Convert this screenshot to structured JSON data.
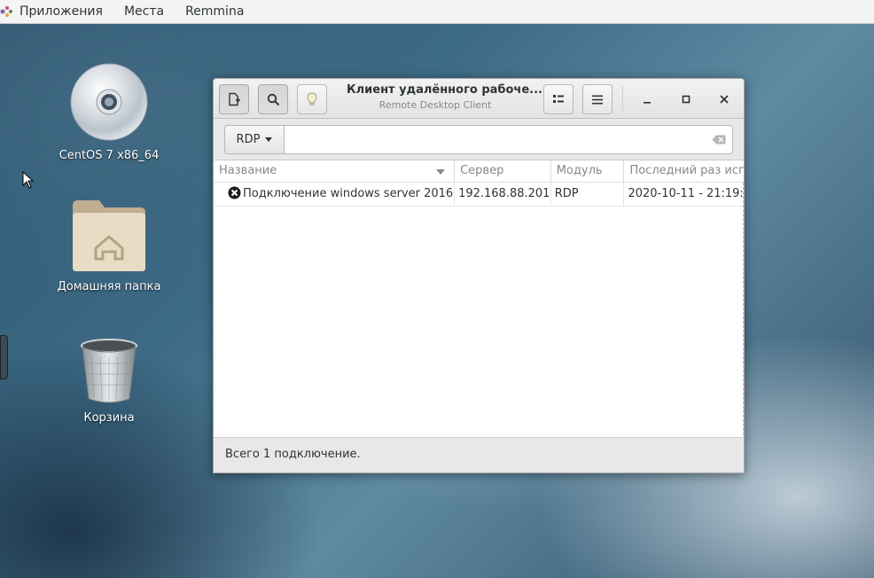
{
  "top_panel": {
    "applications": "Приложения",
    "places": "Места",
    "app_menu": "Remmina"
  },
  "desktop": {
    "icons": [
      {
        "label": "CentOS 7 x86_64",
        "icon": "cd-disc-icon"
      },
      {
        "label": "Домашняя папка",
        "icon": "home-folder-icon"
      },
      {
        "label": "Корзина",
        "icon": "trash-icon"
      }
    ]
  },
  "window": {
    "title": "Клиент удалённого рабоче...",
    "subtitle": "Remote Desktop Client",
    "buttons": [
      "new-connection-icon",
      "search-icon",
      "bulb-icon",
      "view-list-icon",
      "hamburger-menu-icon"
    ],
    "controls": [
      "minimize-icon",
      "maximize-icon",
      "close-icon"
    ],
    "protocol": "RDP",
    "search_value": "",
    "columns": [
      "Название",
      "Сервер",
      "Модуль",
      "Последний раз исп"
    ],
    "rows": [
      {
        "name": "Подключение windows server 2016",
        "server": "192.168.88.201",
        "plugin": "RDP",
        "last_used": "2020-10-11 - 21:19:"
      }
    ],
    "status": "Всего 1 подключение."
  }
}
